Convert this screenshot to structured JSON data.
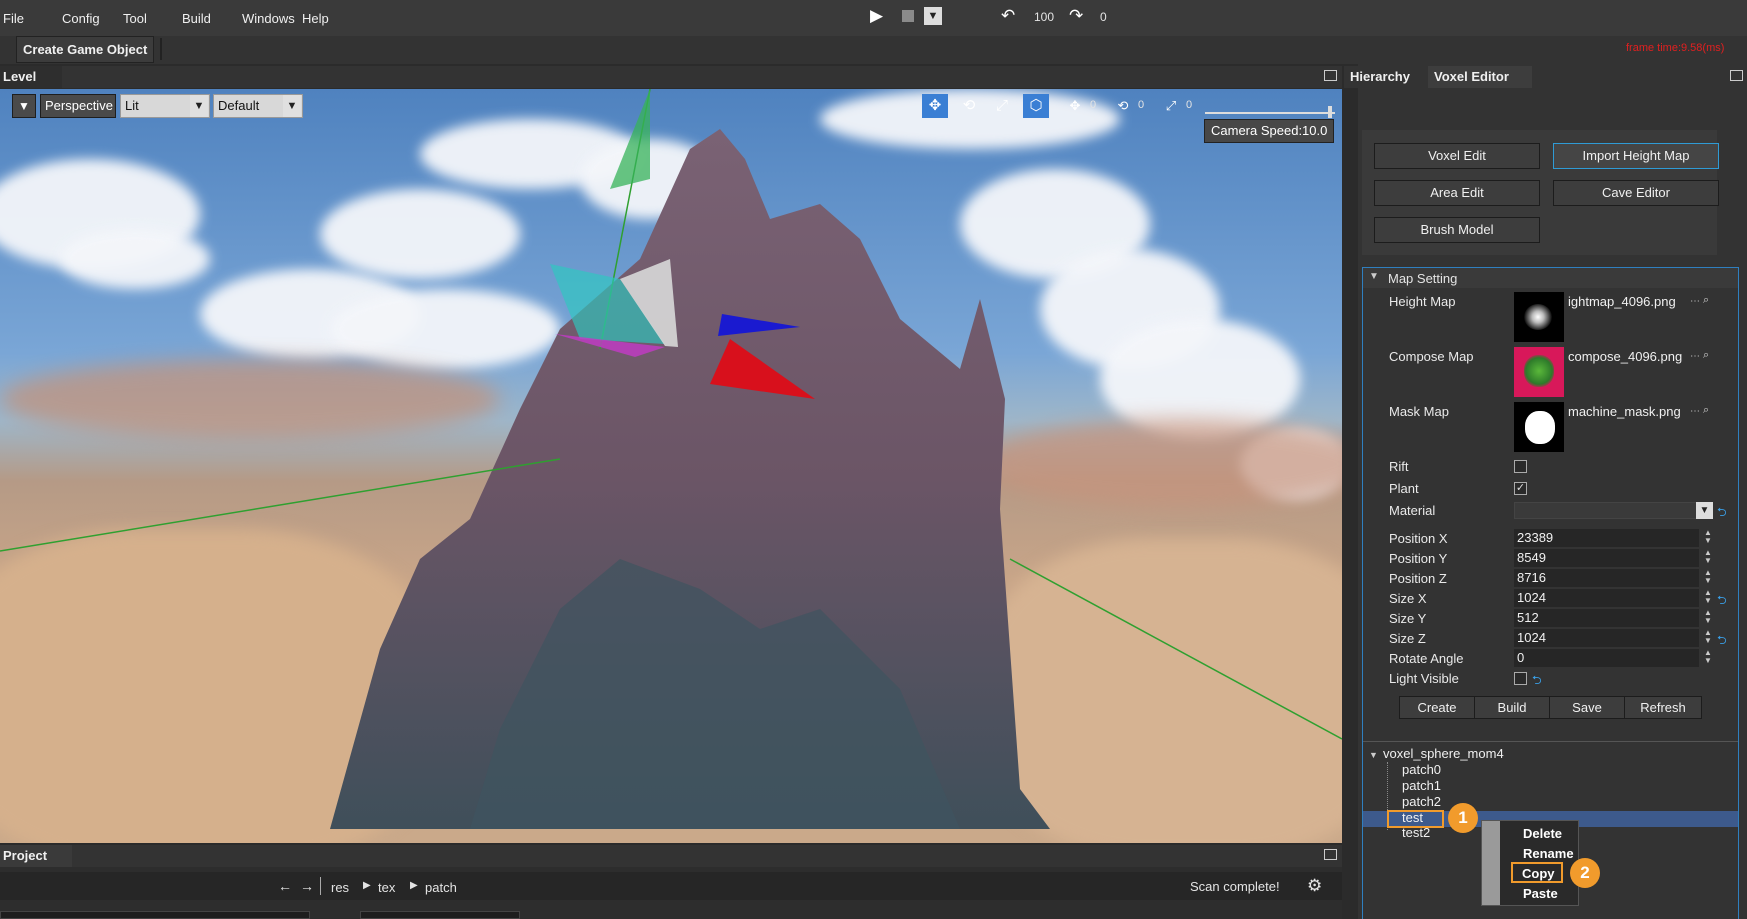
{
  "menu": {
    "file": "File",
    "config": "Config",
    "tool": "Tool",
    "build": "Build",
    "windows": "Windows",
    "help": "Help"
  },
  "playbar": {
    "undo_count": "100",
    "redo_count": "0"
  },
  "frame_time": "frame time:9.58(ms)",
  "toolbar": {
    "create_game_object": "Create Game Object"
  },
  "level_panel": {
    "title": "Level"
  },
  "viewport": {
    "projection": "Perspective",
    "shading": "Lit",
    "layout": "Default",
    "move_snap": "0",
    "rotate_snap": "0",
    "scale_snap": "0",
    "camera_speed": "Camera Speed:10.0"
  },
  "right_tabs": {
    "hierarchy": "Hierarchy",
    "voxel_editor": "Voxel Editor"
  },
  "voxel_buttons": {
    "voxel_edit": "Voxel Edit",
    "import_height_map": "Import Height Map",
    "area_edit": "Area Edit",
    "cave_editor": "Cave Editor",
    "brush_model": "Brush Model"
  },
  "map_setting": {
    "title": "Map Setting",
    "height_map_label": "Height Map",
    "height_map_file": "ightmap_4096.png",
    "compose_map_label": "Compose Map",
    "compose_map_file": "compose_4096.png",
    "mask_map_label": "Mask Map",
    "mask_map_file": "machine_mask.png",
    "rift_label": "Rift",
    "rift_checked": false,
    "plant_label": "Plant",
    "plant_checked": true,
    "material_label": "Material",
    "material_value": "",
    "position_x_label": "Position X",
    "position_x": "23389",
    "position_y_label": "Position Y",
    "position_y": "8549",
    "position_z_label": "Position Z",
    "position_z": "8716",
    "size_x_label": "Size X",
    "size_x": "1024",
    "size_y_label": "Size Y",
    "size_y": "512",
    "size_z_label": "Size Z",
    "size_z": "1024",
    "rotate_angle_label": "Rotate Angle",
    "rotate_angle": "0",
    "light_visible_label": "Light Visible",
    "light_visible_checked": false
  },
  "actions": {
    "create": "Create",
    "build": "Build",
    "save": "Save",
    "refresh": "Refresh"
  },
  "tree": {
    "root": "voxel_sphere_mom4",
    "items": [
      "patch0",
      "patch1",
      "patch2",
      "test",
      "test2"
    ],
    "selected": "test"
  },
  "context_menu": {
    "delete": "Delete",
    "rename": "Rename",
    "copy": "Copy",
    "paste": "Paste"
  },
  "badges": {
    "one": "1",
    "two": "2"
  },
  "project_panel": {
    "title": "Project",
    "path": [
      "res",
      "tex",
      "patch"
    ],
    "status": "Scan complete!"
  },
  "colors": {
    "accent_orange": "#f19b2c",
    "selection_blue": "#3d5a8c",
    "frame_time_red": "#e02020",
    "link_blue": "#3aa0e8"
  }
}
